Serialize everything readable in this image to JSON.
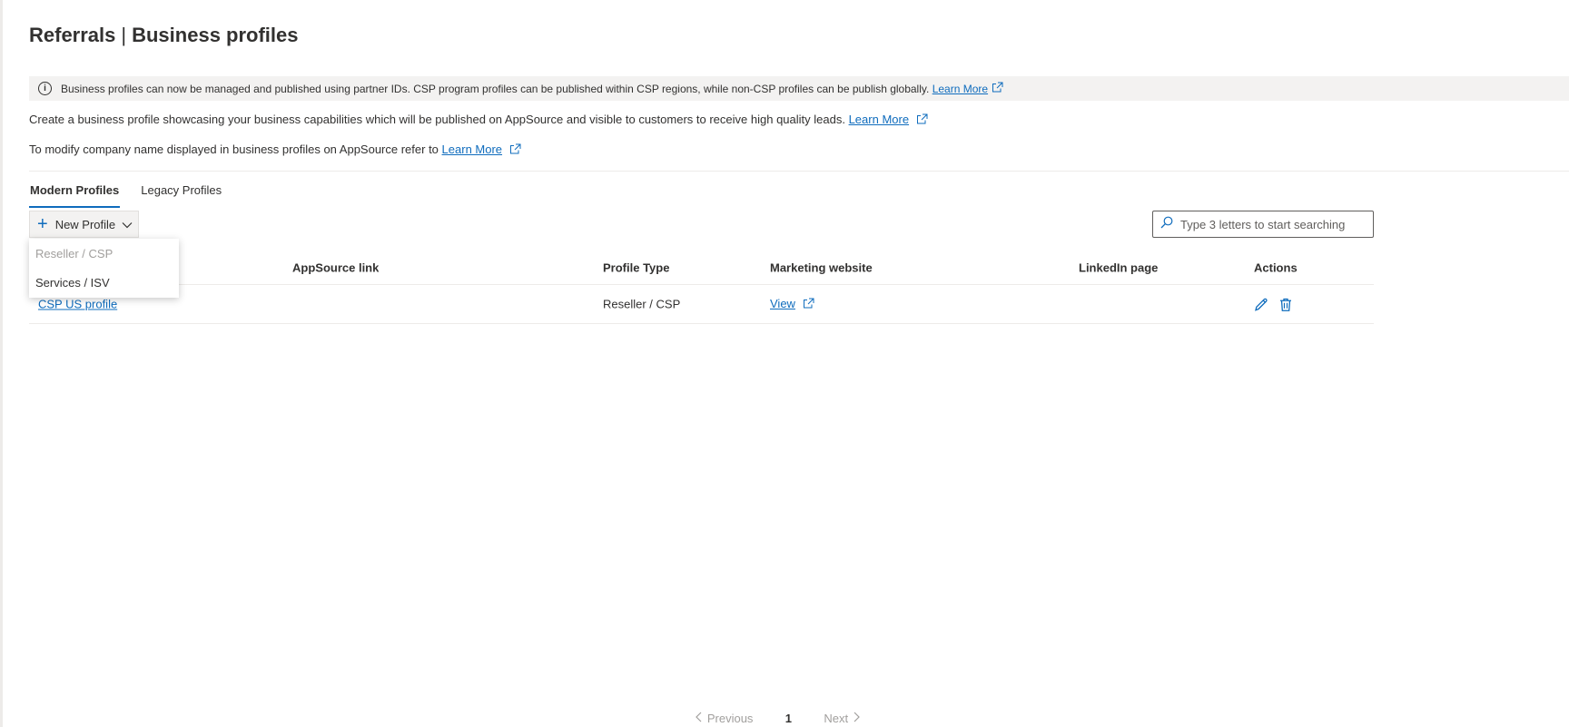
{
  "header": {
    "title_strong": "Referrals",
    "separator": "|",
    "title_rest": "Business profiles"
  },
  "info_bar": {
    "icon": "info-icon",
    "text": "Business profiles can now be managed and published using partner IDs. CSP program profiles can be published within CSP regions, while non-CSP profiles can be publish globally.",
    "link": "Learn More"
  },
  "description": {
    "line1_text": "Create a business profile showcasing your business capabilities which will be published on AppSource and visible to customers to receive high quality leads.",
    "line1_link": "Learn More",
    "line2_text": "To modify company name displayed in business profiles on AppSource refer to",
    "line2_link": "Learn More"
  },
  "tabs": [
    {
      "label": "Modern Profiles",
      "active": true
    },
    {
      "label": "Legacy Profiles",
      "active": false
    }
  ],
  "toolbar": {
    "new_profile_label": "New Profile",
    "new_profile_icon": "plus-icon",
    "menu": [
      {
        "label": "Reseller / CSP",
        "disabled": true
      },
      {
        "label": "Services / ISV",
        "disabled": false
      }
    ]
  },
  "search": {
    "placeholder": "Type 3 letters to start searching"
  },
  "table": {
    "columns": [
      "AppSource link",
      "Profile Type",
      "Marketing website",
      "LinkedIn page",
      "Actions"
    ],
    "rows": [
      {
        "name": "CSP US profile",
        "appsource_link": "",
        "profile_type": "Reseller / CSP",
        "marketing_website": "View",
        "linkedin_page": ""
      }
    ]
  },
  "pagination": {
    "previous": "Previous",
    "current_page": "1",
    "next": "Next"
  },
  "colors": {
    "accent": "#0f6cbd",
    "info_bar_bg": "#f3f2f1",
    "disabled_text": "#a19f9d",
    "text": "#323130"
  }
}
